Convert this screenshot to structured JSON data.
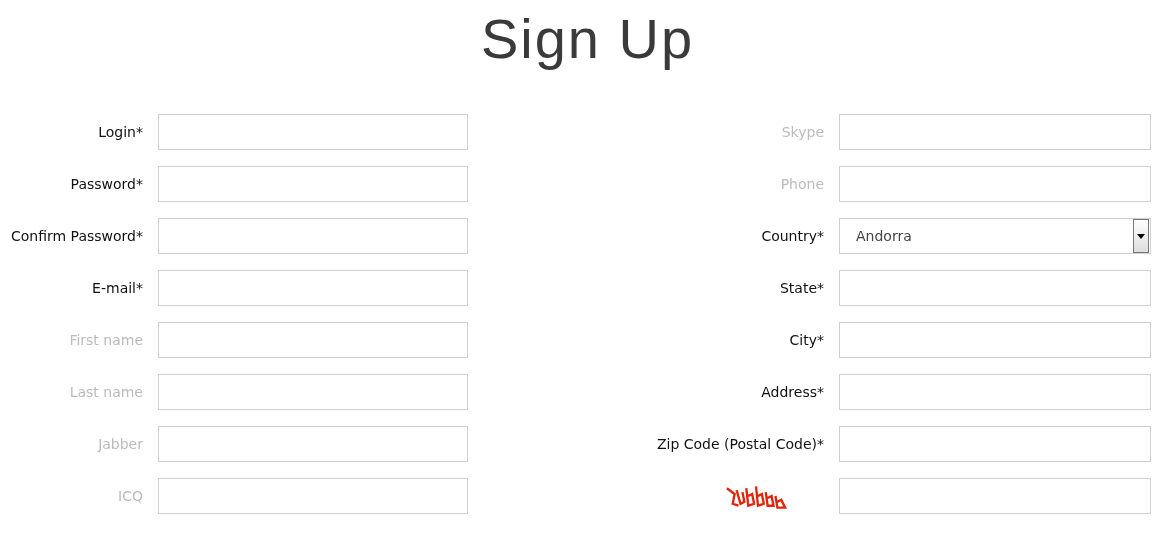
{
  "title": "Sign Up",
  "columns": [
    {
      "fields": [
        {
          "kind": "text",
          "label": "Login*",
          "required": true
        },
        {
          "kind": "text",
          "label": "Password*",
          "required": true
        },
        {
          "kind": "text",
          "label": "Confirm Password*",
          "required": true
        },
        {
          "kind": "text",
          "label": "E-mail*",
          "required": true
        },
        {
          "kind": "text",
          "label": "First name",
          "required": false
        },
        {
          "kind": "text",
          "label": "Last name",
          "required": false
        },
        {
          "kind": "text",
          "label": "Jabber",
          "required": false
        },
        {
          "kind": "text",
          "label": "ICQ",
          "required": false
        }
      ]
    },
    {
      "fields": [
        {
          "kind": "text",
          "label": "Skype",
          "required": false
        },
        {
          "kind": "text",
          "label": "Phone",
          "required": false
        },
        {
          "kind": "select",
          "label": "Country*",
          "required": true,
          "value": "Andorra"
        },
        {
          "kind": "text",
          "label": "State*",
          "required": true
        },
        {
          "kind": "text",
          "label": "City*",
          "required": true
        },
        {
          "kind": "text",
          "label": "Address*",
          "required": true
        },
        {
          "kind": "text",
          "label": "Zip Code (Postal Code)*",
          "required": true
        },
        {
          "kind": "captcha"
        }
      ]
    }
  ]
}
